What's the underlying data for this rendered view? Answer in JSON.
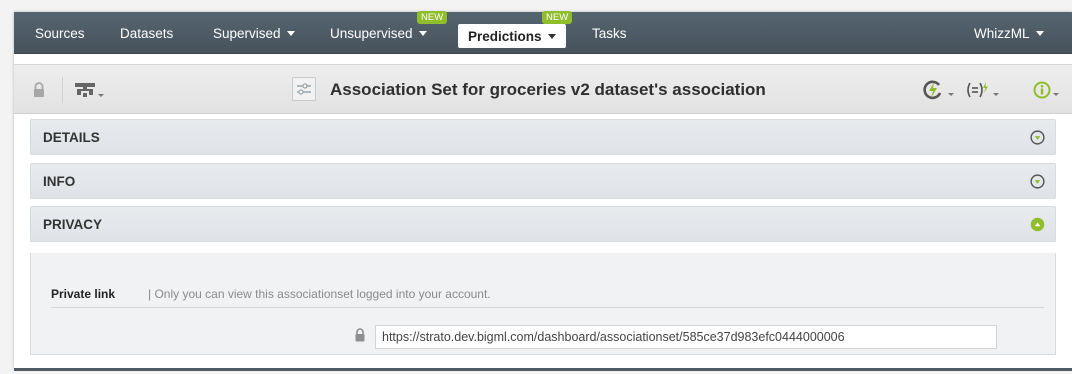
{
  "nav": {
    "items": [
      {
        "label": "Sources"
      },
      {
        "label": "Datasets"
      },
      {
        "label": "Supervised"
      },
      {
        "label": "Unsupervised",
        "badge": "NEW"
      },
      {
        "label": "Predictions",
        "badge": "NEW",
        "active": true
      },
      {
        "label": "Tasks"
      }
    ],
    "right_menu": "WhizzML"
  },
  "toolbar": {
    "title": "Association Set for groceries v2 dataset's association"
  },
  "panels": {
    "details": "DETAILS",
    "info": "INFO",
    "privacy": "PRIVACY"
  },
  "privacy": {
    "label": "Private link",
    "description": "| Only you can view this associationset logged into your account.",
    "link": "https://strato.dev.bigml.com/dashboard/associationset/585ce37d983efc0444000006"
  },
  "colors": {
    "nav_bg": "#4f5d67",
    "accent_green": "#8fbd2c"
  }
}
